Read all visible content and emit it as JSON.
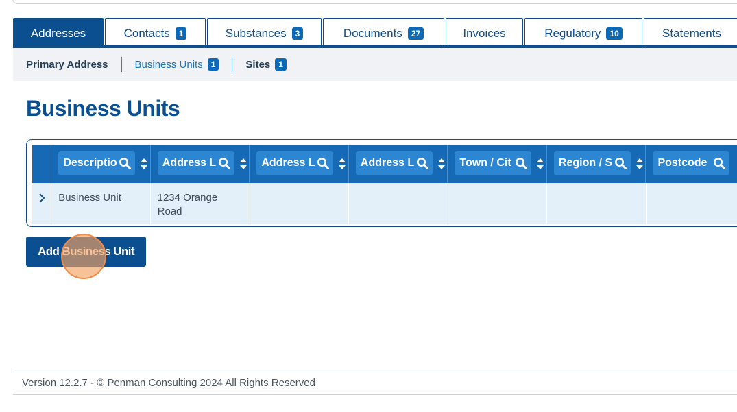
{
  "tabs": [
    {
      "label": "Addresses",
      "badge": null
    },
    {
      "label": "Contacts",
      "badge": "1"
    },
    {
      "label": "Substances",
      "badge": "3"
    },
    {
      "label": "Documents",
      "badge": "27"
    },
    {
      "label": "Invoices",
      "badge": null
    },
    {
      "label": "Regulatory",
      "badge": "10"
    },
    {
      "label": "Statements",
      "badge": null
    }
  ],
  "subnav": [
    {
      "label": "Primary Address",
      "badge": null
    },
    {
      "label": "Business Units",
      "badge": "1"
    },
    {
      "label": "Sites",
      "badge": "1"
    }
  ],
  "page": {
    "title": "Business Units"
  },
  "grid": {
    "columns": [
      "Descriptio",
      "Address L",
      "Address L",
      "Address L",
      "Town / Cit",
      "Region / S",
      "Postcode"
    ],
    "rows": [
      [
        "Business Unit",
        "1234 Orange Road",
        "",
        "",
        "",
        "",
        ""
      ]
    ]
  },
  "actions": {
    "add_label": "Add Business Unit"
  },
  "footer": {
    "text": "Version 12.2.7 - © Penman Consulting 2024 All Rights Reserved"
  },
  "colors": {
    "primary": "#0b4f91",
    "header": "#1569b5",
    "row": "#e3f0fa",
    "badge": "#0b69b7"
  }
}
